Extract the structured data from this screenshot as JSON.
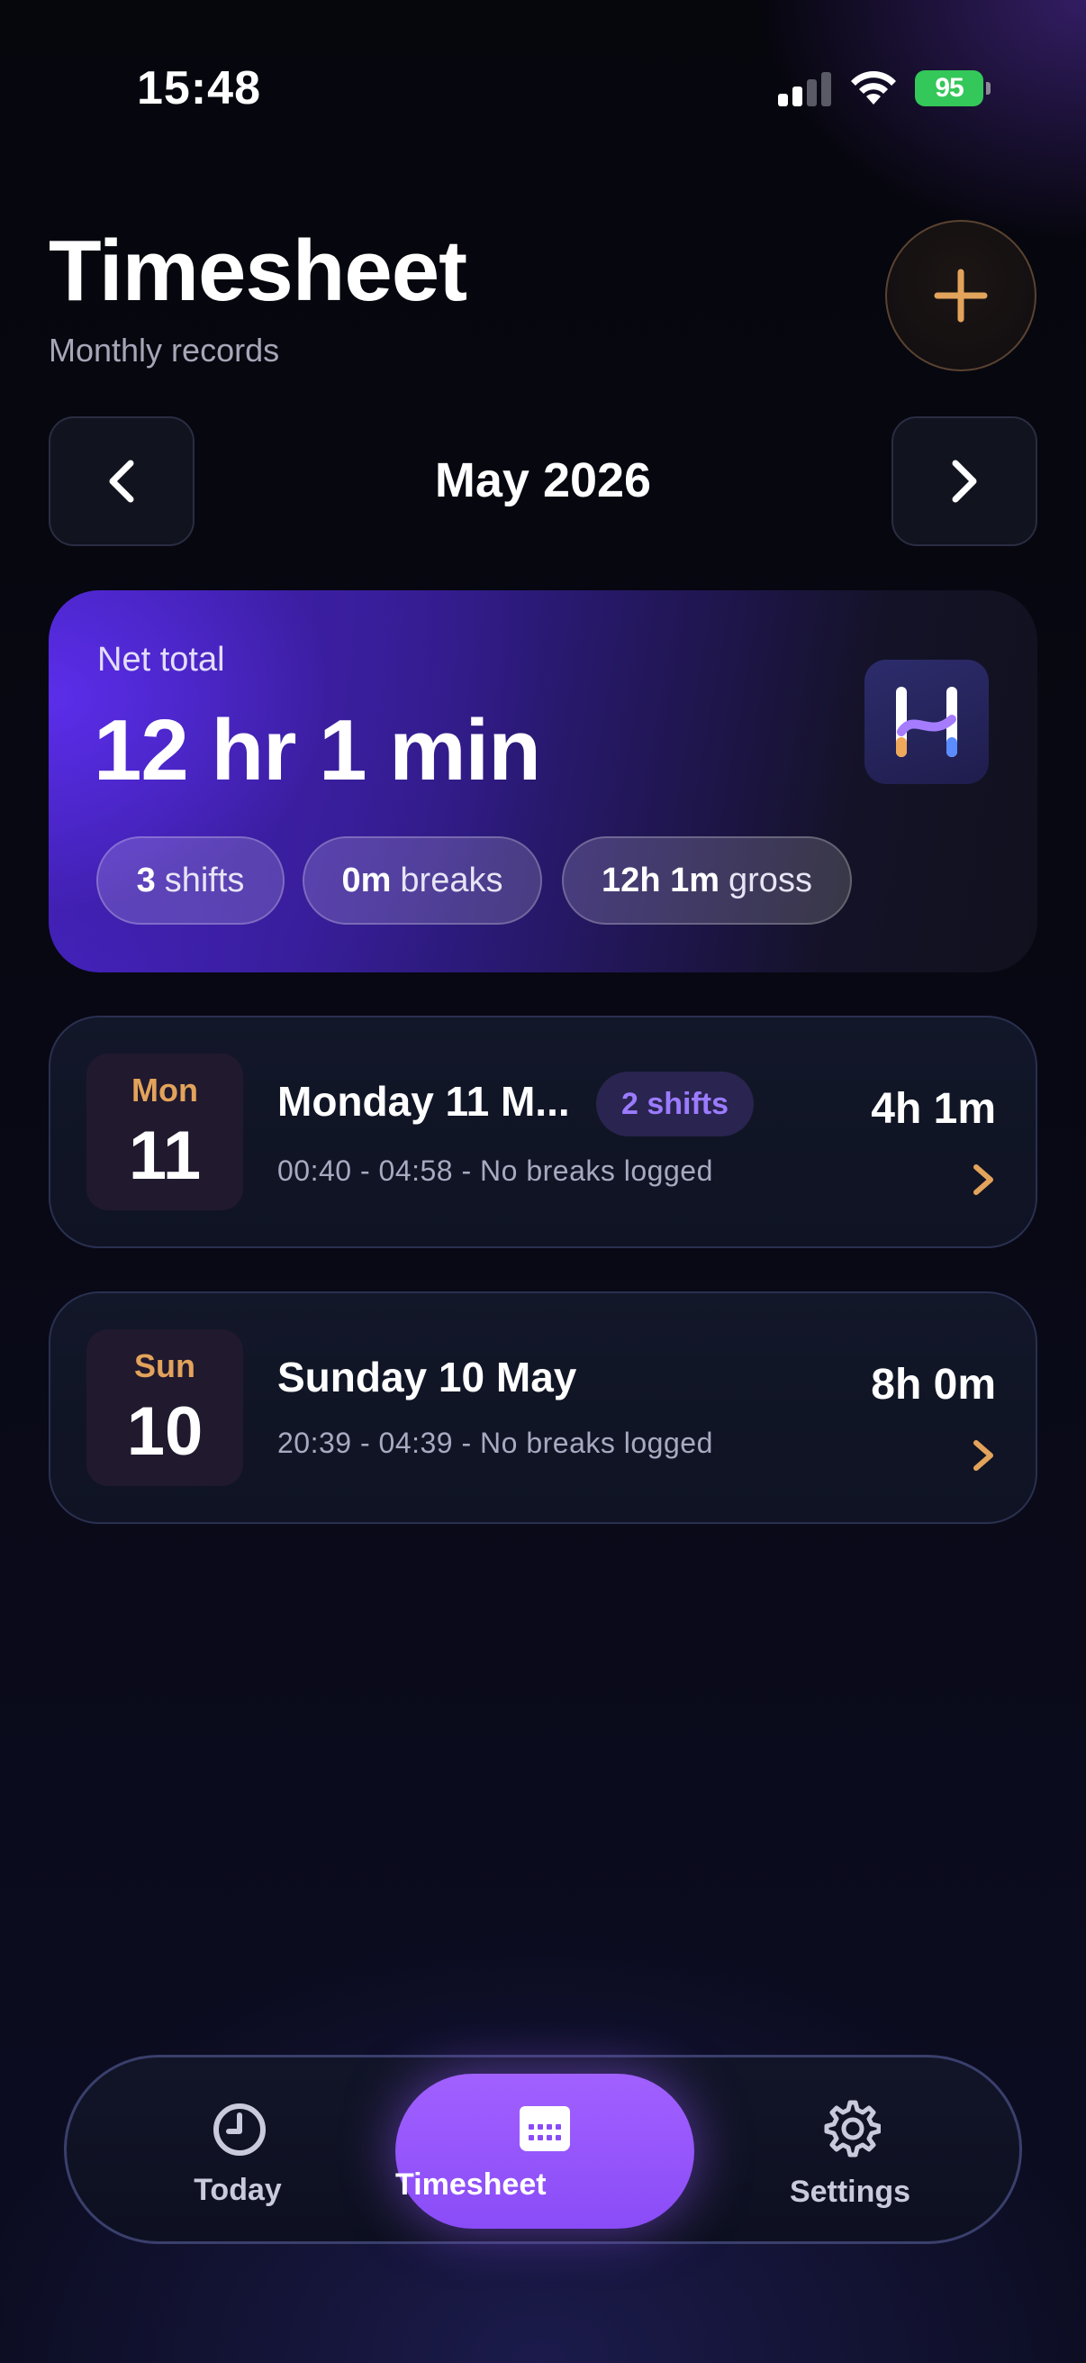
{
  "status_bar": {
    "time": "15:48",
    "battery": "95"
  },
  "header": {
    "title": "Timesheet",
    "subtitle": "Monthly records"
  },
  "month_nav": {
    "label": "May 2026"
  },
  "summary": {
    "label": "Net total",
    "total": "12 hr 1 min",
    "stats": [
      {
        "value": "3",
        "unit": "shifts"
      },
      {
        "value": "0m",
        "unit": "breaks"
      },
      {
        "value": "12h 1m",
        "unit": "gross"
      }
    ]
  },
  "days": [
    {
      "dow": "Mon",
      "num": "11",
      "title": "Monday 11 M...",
      "badge": "2 shifts",
      "detail": "00:40 - 04:58 - No breaks logged",
      "total": "4h 1m"
    },
    {
      "dow": "Sun",
      "num": "10",
      "title": "Sunday 10 May",
      "detail": "20:39 - 04:39 - No breaks logged",
      "total": "8h 0m"
    }
  ],
  "tabs": [
    {
      "label": "Today"
    },
    {
      "label": "Timesheet"
    },
    {
      "label": "Settings"
    }
  ],
  "colors": {
    "accent": "#8a4cf7",
    "orange": "#e2a35b",
    "battery": "#34c759"
  },
  "icons": [
    "plus-icon",
    "chevron-left-icon",
    "chevron-right-icon",
    "clock-icon",
    "calendar-icon",
    "gear-icon",
    "app-logo-icon"
  ]
}
